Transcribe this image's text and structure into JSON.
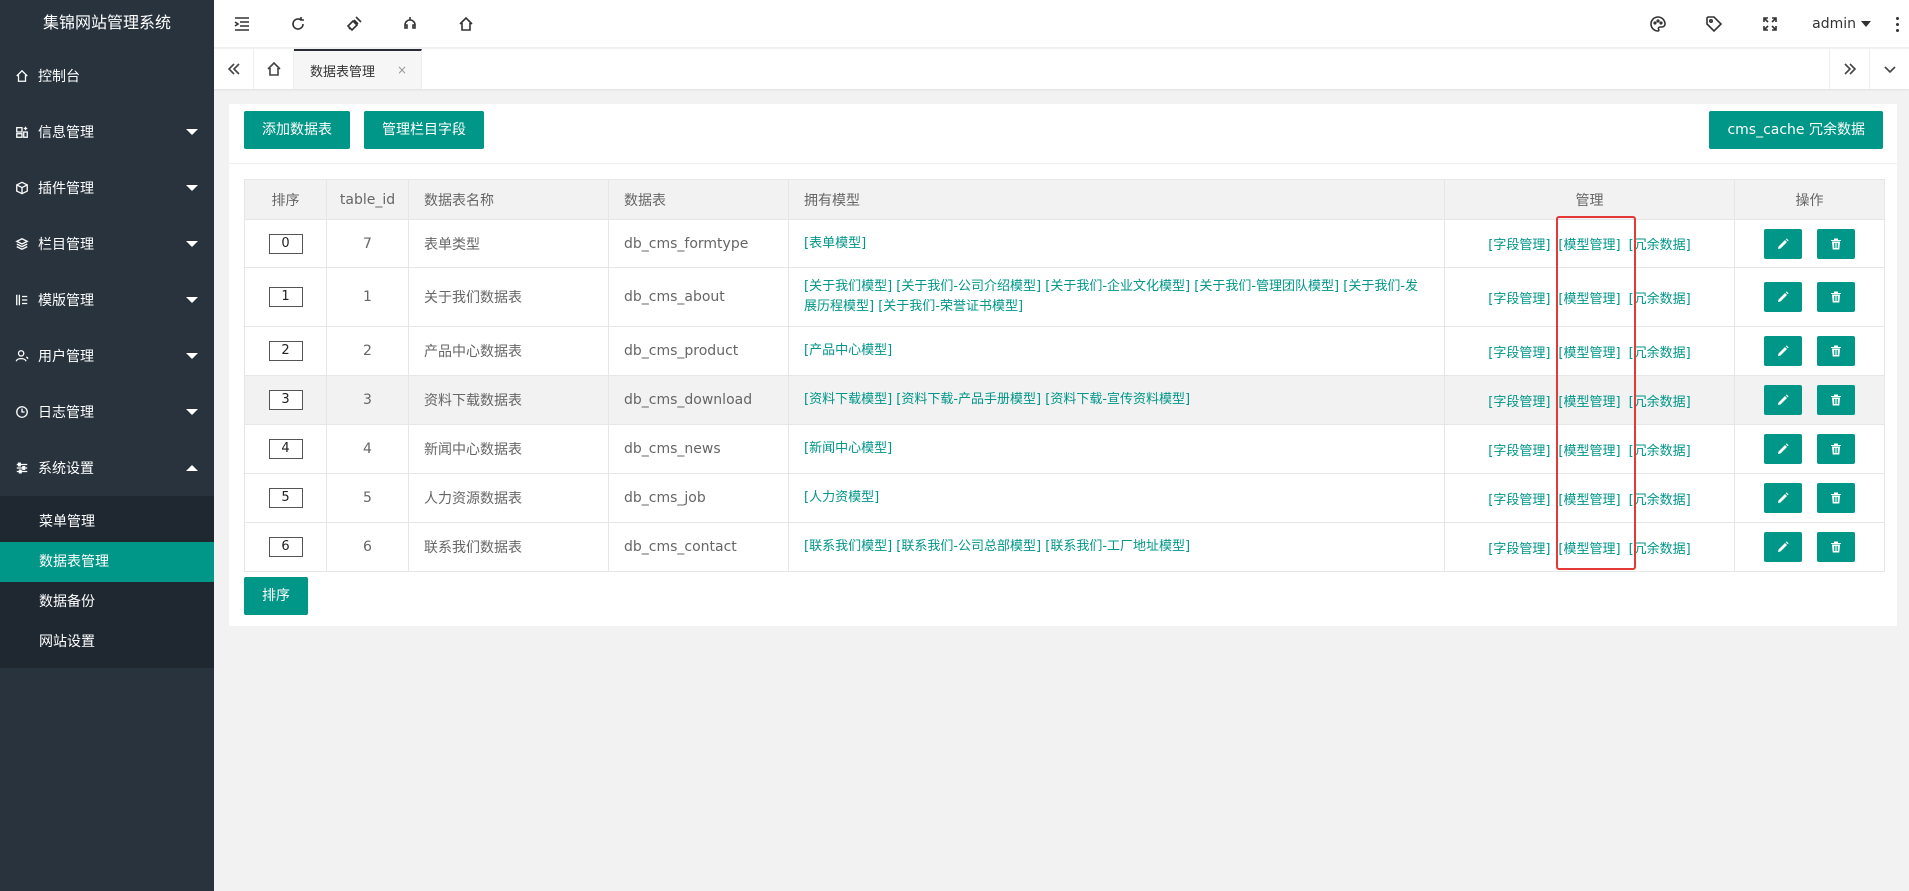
{
  "sidebar": {
    "logo": "集锦网站管理系统",
    "items": [
      {
        "label": "控制台",
        "icon": "home-icon"
      },
      {
        "label": "信息管理",
        "icon": "info-icon"
      },
      {
        "label": "插件管理",
        "icon": "cube-icon"
      },
      {
        "label": "栏目管理",
        "icon": "layers-icon"
      },
      {
        "label": "模版管理",
        "icon": "template-icon"
      },
      {
        "label": "用户管理",
        "icon": "user-icon"
      },
      {
        "label": "日志管理",
        "icon": "clock-icon"
      },
      {
        "label": "系统设置",
        "icon": "sliders-icon"
      }
    ],
    "subitems": [
      "菜单管理",
      "数据表管理",
      "数据备份",
      "网站设置"
    ]
  },
  "header": {
    "user": "admin"
  },
  "tabs": {
    "active_label": "数据表管理",
    "close_glyph": "×"
  },
  "toolbar": {
    "add_table": "添加数据表",
    "manage_fields": "管理栏目字段",
    "cms_cache": "cms_cache 冗余数据"
  },
  "table": {
    "headers": [
      "排序",
      "table_id",
      "数据表名称",
      "数据表",
      "拥有模型",
      "管理",
      "操作"
    ],
    "manage_links": [
      "[字段管理]",
      "[模型管理]",
      "[冗余数据]"
    ],
    "rows": [
      {
        "sort": "0",
        "table_id": "7",
        "name": "表单类型",
        "table": "db_cms_formtype",
        "models": [
          "[表单模型]"
        ]
      },
      {
        "sort": "1",
        "table_id": "1",
        "name": "关于我们数据表",
        "table": "db_cms_about",
        "models": [
          "[关于我们模型]",
          "[关于我们-公司介绍模型]",
          "[关于我们-企业文化模型]",
          "[关于我们-管理团队模型]",
          "[关于我们-发展历程模型]",
          "[关于我们-荣誉证书模型]"
        ]
      },
      {
        "sort": "2",
        "table_id": "2",
        "name": "产品中心数据表",
        "table": "db_cms_product",
        "models": [
          "[产品中心模型]"
        ]
      },
      {
        "sort": "3",
        "table_id": "3",
        "name": "资料下载数据表",
        "table": "db_cms_download",
        "models": [
          "[资料下载模型]",
          "[资料下载-产品手册模型]",
          "[资料下载-宣传资料模型]"
        ]
      },
      {
        "sort": "4",
        "table_id": "4",
        "name": "新闻中心数据表",
        "table": "db_cms_news",
        "models": [
          "[新闻中心模型]"
        ]
      },
      {
        "sort": "5",
        "table_id": "5",
        "name": "人力资源数据表",
        "table": "db_cms_job",
        "models": [
          "[人力资模型]"
        ]
      },
      {
        "sort": "6",
        "table_id": "6",
        "name": "联系我们数据表",
        "table": "db_cms_contact",
        "models": [
          "[联系我们模型]",
          "[联系我们-公司总部模型]",
          "[联系我们-工厂地址模型]"
        ]
      }
    ]
  },
  "sort_button": "排序",
  "colors": {
    "accent": "#009688",
    "sidebar": "#28333e",
    "highlight_box": "#e53935"
  }
}
